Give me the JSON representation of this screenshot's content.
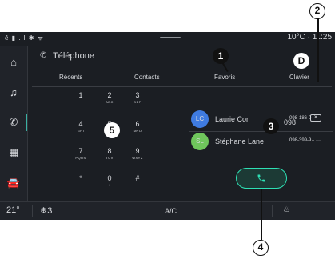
{
  "status_bar": {
    "left_icons": "ê ▮ .ıl ✱ ᯤ",
    "temperature": "10°C",
    "time": "· 11:25"
  },
  "side_rail": {
    "items": [
      {
        "name": "home",
        "glyph": "⌂"
      },
      {
        "name": "music",
        "glyph": "♫"
      },
      {
        "name": "phone",
        "glyph": "✆",
        "active": true
      },
      {
        "name": "apps",
        "glyph": "▦"
      },
      {
        "name": "vehicle",
        "glyph": "🚘"
      }
    ]
  },
  "header": {
    "title": "Téléphone"
  },
  "tabs": [
    {
      "label": "Récents"
    },
    {
      "label": "Contacts"
    },
    {
      "label": "Favoris"
    },
    {
      "label": "Clavier"
    }
  ],
  "keypad": {
    "keys": [
      {
        "digit": "1",
        "letters": ""
      },
      {
        "digit": "2",
        "letters": "ABC"
      },
      {
        "digit": "3",
        "letters": "DEF"
      },
      {
        "digit": "4",
        "letters": "GHI"
      },
      {
        "digit": "5",
        "letters": "JKL"
      },
      {
        "digit": "6",
        "letters": "MNO"
      },
      {
        "digit": "7",
        "letters": "PQRS"
      },
      {
        "digit": "8",
        "letters": "TUV"
      },
      {
        "digit": "9",
        "letters": "WXYZ"
      },
      {
        "digit": "*",
        "letters": ""
      },
      {
        "digit": "0",
        "letters": "+"
      },
      {
        "digit": "#",
        "letters": ""
      }
    ]
  },
  "dial_display": {
    "value": "098"
  },
  "contacts": [
    {
      "initials": "LC",
      "name": "Laurie Cor",
      "number": "098-186-0·· ···",
      "color": "#3f7be0"
    },
    {
      "initials": "SL",
      "name": "Stéphane Lane",
      "number": "098-399-9·· ···",
      "color": "#6fc65c"
    }
  ],
  "bottom_bar": {
    "temperature": "21°",
    "fan": "❄3",
    "ac": "A/C",
    "seat": "♨"
  },
  "callouts": {
    "c1": "1",
    "c2": "2",
    "c3": "3",
    "c4": "4",
    "c5": "5",
    "cD": "D"
  },
  "colors": {
    "screen_bg": "#1b1e23",
    "accent": "#2ee0b4"
  }
}
